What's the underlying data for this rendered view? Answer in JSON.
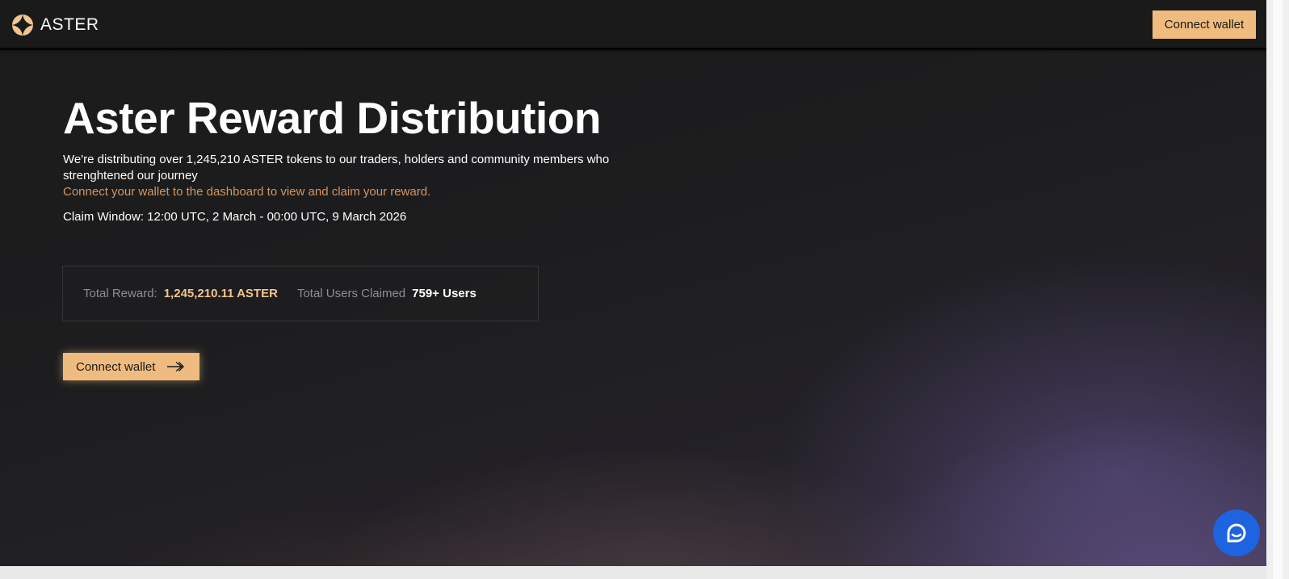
{
  "header": {
    "brand_name": "ASTER",
    "connect_label": "Connect wallet"
  },
  "hero": {
    "title": "Aster Reward Distribution",
    "description": "We're distributing over 1,245,210 ASTER tokens to our traders, holders and community members who strenghtened our journey",
    "cta_text": "Connect your wallet to the dashboard to view and claim your reward.",
    "claim_window": "Claim Window: 12:00 UTC, 2 March - 00:00 UTC, 9 March 2026",
    "stats": {
      "total_reward_label": "Total Reward:",
      "total_reward_value": "1,245,210.11 ASTER",
      "total_users_label": "Total Users Claimed",
      "total_users_value": "759+ Users"
    },
    "connect_label": "Connect wallet"
  },
  "icons": {
    "logo": "aster-logo-icon",
    "arrow": "arrow-right-icon",
    "chat": "chat-icon"
  },
  "colors": {
    "accent": "#efbb7e",
    "cta_text": "#d59460",
    "reward_value": "#f2c48f",
    "chat_button": "#1e63e0",
    "navbar": "#1a1a1a"
  }
}
